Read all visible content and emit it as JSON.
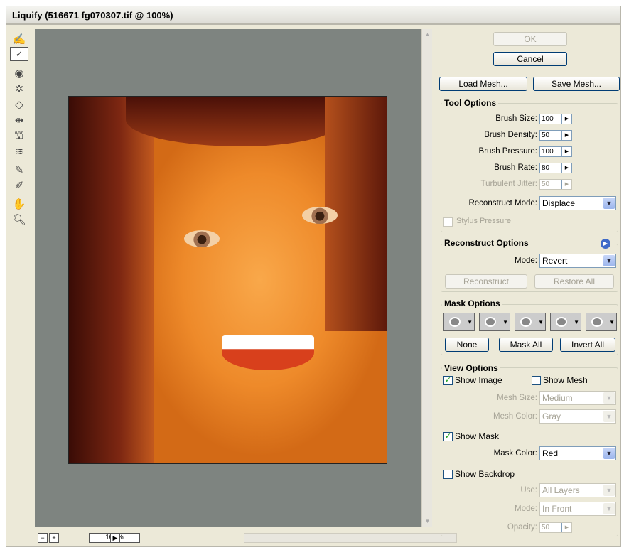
{
  "window": {
    "title": "Liquify (516671 fg070307.tif @ 100%)"
  },
  "toolbar": {
    "tools": [
      "forward-warp",
      "reconstruct",
      "twirl",
      "pucker",
      "bloat",
      "push-left",
      "mirror",
      "turbulence",
      "freeze-mask",
      "thaw-mask",
      "hand",
      "zoom"
    ]
  },
  "canvas": {
    "zoom": "100%"
  },
  "buttons": {
    "ok": "OK",
    "cancel": "Cancel",
    "load_mesh": "Load Mesh...",
    "save_mesh": "Save Mesh..."
  },
  "tool_options": {
    "title": "Tool Options",
    "brush_size_label": "Brush Size:",
    "brush_size": "100",
    "brush_density_label": "Brush Density:",
    "brush_density": "50",
    "brush_pressure_label": "Brush Pressure:",
    "brush_pressure": "100",
    "brush_rate_label": "Brush Rate:",
    "brush_rate": "80",
    "turbulent_jitter_label": "Turbulent Jitter:",
    "turbulent_jitter": "50",
    "reconstruct_mode_label": "Reconstruct Mode:",
    "reconstruct_mode": "Displace",
    "stylus_pressure_label": "Stylus Pressure"
  },
  "reconstruct_options": {
    "title": "Reconstruct Options",
    "mode_label": "Mode:",
    "mode": "Revert",
    "reconstruct_label": "Reconstruct",
    "restore_all_label": "Restore All"
  },
  "mask_options": {
    "title": "Mask Options",
    "none_label": "None",
    "mask_all_label": "Mask All",
    "invert_all_label": "Invert All"
  },
  "view_options": {
    "title": "View Options",
    "show_image_label": "Show Image",
    "show_image": true,
    "show_mesh_label": "Show Mesh",
    "show_mesh": false,
    "mesh_size_label": "Mesh Size:",
    "mesh_size": "Medium",
    "mesh_color_label": "Mesh Color:",
    "mesh_color": "Gray",
    "show_mask_label": "Show Mask",
    "show_mask": true,
    "mask_color_label": "Mask Color:",
    "mask_color": "Red",
    "show_backdrop_label": "Show Backdrop",
    "show_backdrop": false,
    "use_label": "Use:",
    "use": "All Layers",
    "mode_label": "Mode:",
    "mode": "In Front",
    "opacity_label": "Opacity:",
    "opacity": "50"
  }
}
